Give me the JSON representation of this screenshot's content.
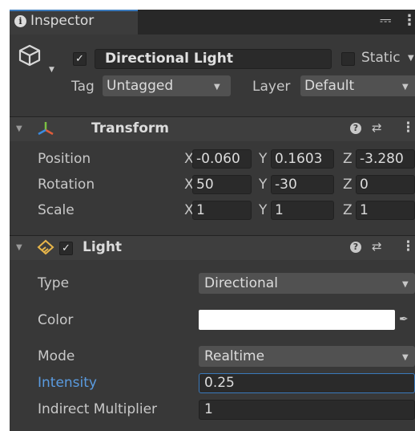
{
  "tab": {
    "title": "Inspector",
    "info_icon": "info-icon",
    "lock_icon": "lock-icon",
    "menu_icon": "kebab-menu-icon"
  },
  "header": {
    "object_icon": "cube-icon",
    "active": true,
    "name": "Directional Light",
    "static_label": "Static",
    "static_checked": false,
    "tag_label": "Tag",
    "tag_value": "Untagged",
    "layer_label": "Layer",
    "layer_value": "Default"
  },
  "transform": {
    "title": "Transform",
    "rows": [
      {
        "label": "Position",
        "x": "-0.060",
        "y": "0.1603",
        "z": "-3.280"
      },
      {
        "label": "Rotation",
        "x": "50",
        "y": "-30",
        "z": "0"
      },
      {
        "label": "Scale",
        "x": "1",
        "y": "1",
        "z": "1"
      }
    ],
    "axes": [
      "X",
      "Y",
      "Z"
    ]
  },
  "light": {
    "title": "Light",
    "enabled": true,
    "type_label": "Type",
    "type_value": "Directional",
    "color_label": "Color",
    "color_value": "#ffffff",
    "mode_label": "Mode",
    "mode_value": "Realtime",
    "intensity_label": "Intensity",
    "intensity_value": "0.25",
    "indirect_label": "Indirect Multiplier",
    "indirect_value": "1"
  },
  "colors": {
    "accent": "#3a79bb",
    "panel": "#383838",
    "highlight_label": "#5a9be0"
  }
}
